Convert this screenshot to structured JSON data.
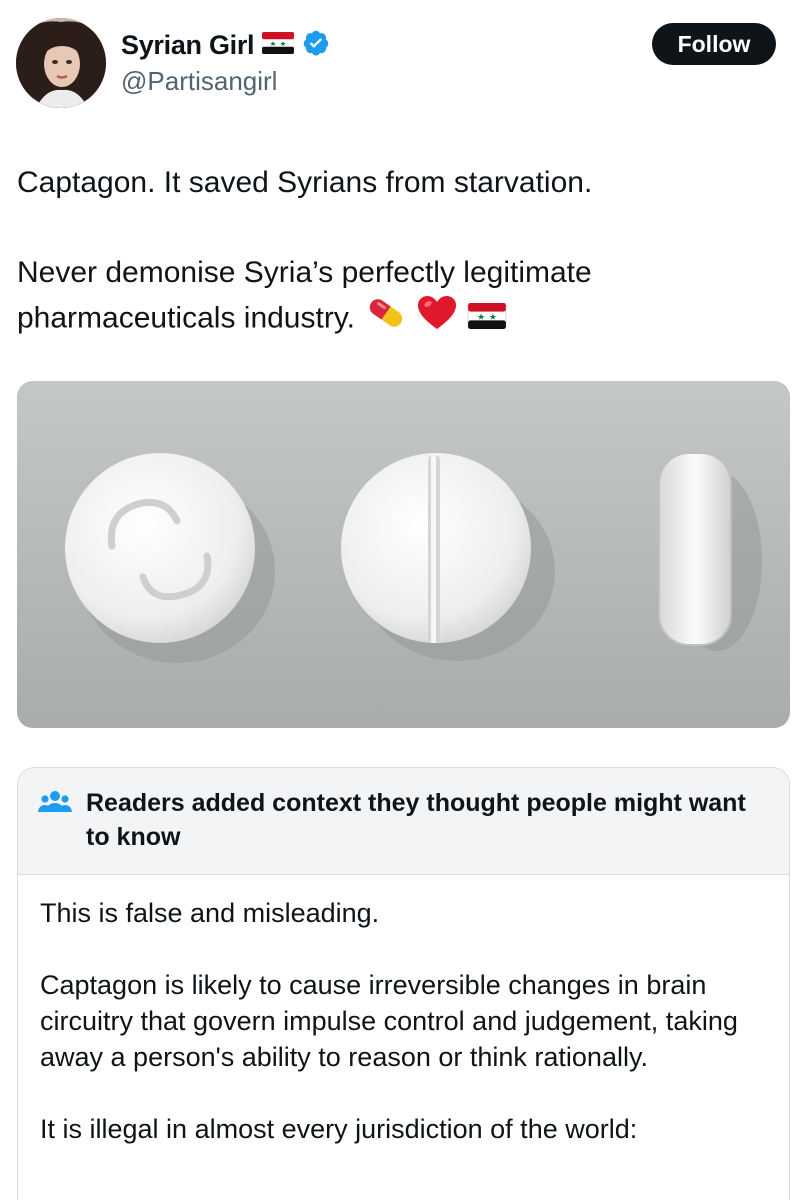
{
  "post": {
    "author": {
      "display_name": "Syrian Girl",
      "handle": "@Partisangirl",
      "flag_emoji": "syria-flag-icon",
      "verified": true
    },
    "follow_label": "Follow",
    "text": {
      "line1": "Captagon.  It saved Syrians from starvation.",
      "line2": "Never demonise Syria’s perfectly legitimate",
      "line3": "pharmaceuticals industry.",
      "emojis": [
        "pill-icon",
        "red-heart-icon",
        "syria-flag-icon"
      ]
    },
    "media": {
      "description_icon": "pill-photo"
    }
  },
  "community_note": {
    "title": "Readers added context they thought people might want to know",
    "body": {
      "p1": "This is false and misleading.",
      "p2": "Captagon is likely to cause irreversible changes in brain circuitry that govern impulse control and judgement, taking away a person's ability to reason or think rationally.",
      "p3": "It is illegal in almost every jurisdiction of the world:"
    }
  },
  "colors": {
    "text": "#0f1419",
    "secondary": "#536471",
    "verified": "#1d9bf0",
    "follow_bg": "#0f1419",
    "note_header_bg": "#f3f4f5",
    "note_icon": "#1d9bf0"
  }
}
